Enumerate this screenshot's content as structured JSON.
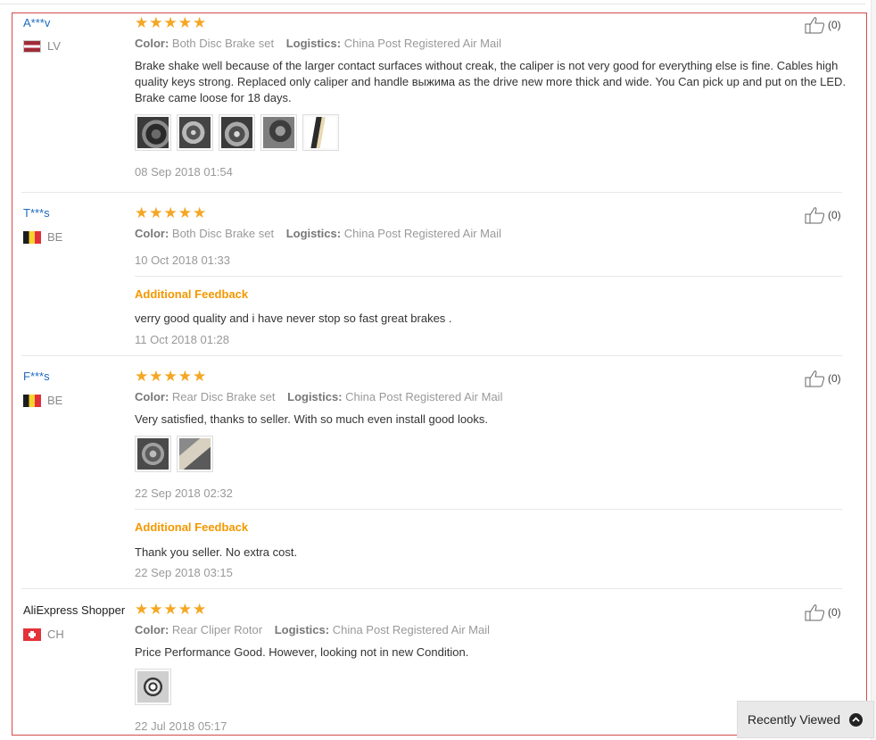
{
  "recently_viewed": {
    "label": "Recently Viewed",
    "icon": "chevron-up-circle-icon"
  },
  "reviews": [
    {
      "user": "A***v",
      "country_code": "LV",
      "stars": 5,
      "color_label": "Color:",
      "color_value": "Both Disc Brake set",
      "logistics_label": "Logistics:",
      "logistics_value": "China Post Registered Air Mail",
      "text": "Brake shake well because of the larger contact surfaces without creak, the caliper is not very good for everything else is fine. Cables high quality keys strong. Replaced only caliper and handle выжима as the drive new more thick and wide. You Can pick up and put on the LED. Brake came loose for 18 days.",
      "photo_count": 5,
      "date": "08 Sep 2018 01:54",
      "likes": "(0)"
    },
    {
      "user": "T***s",
      "country_code": "BE",
      "stars": 5,
      "color_label": "Color:",
      "color_value": "Both Disc Brake set",
      "logistics_label": "Logistics:",
      "logistics_value": "China Post Registered Air Mail",
      "date": "10 Oct 2018 01:33",
      "likes": "(0)",
      "additional_feedback_label": "Additional Feedback",
      "additional_text": "verry good quality and i have never stop so fast great brakes .",
      "additional_date": "11 Oct 2018 01:28"
    },
    {
      "user": "F***s",
      "country_code": "BE",
      "stars": 5,
      "color_label": "Color:",
      "color_value": "Rear Disc Brake set",
      "logistics_label": "Logistics:",
      "logistics_value": "China Post Registered Air Mail",
      "text": "Very satisfied, thanks to seller. With so much even install good looks.",
      "photo_count": 2,
      "date": "22 Sep 2018 02:32",
      "likes": "(0)",
      "additional_feedback_label": "Additional Feedback",
      "additional_text": "Thank you seller. No extra cost.",
      "additional_date": "22 Sep 2018 03:15"
    },
    {
      "user": "AliExpress Shopper",
      "country_code": "CH",
      "stars": 5,
      "color_label": "Color:",
      "color_value": "Rear Cliper Rotor",
      "logistics_label": "Logistics:",
      "logistics_value": "China Post Registered Air Mail",
      "text": "Price Performance Good. However, looking not in new Condition.",
      "photo_count": 1,
      "date": "22 Jul 2018 05:17",
      "likes": "(0)"
    }
  ],
  "colors": {
    "user_link": "#1f6ac1",
    "star": "#f5a623",
    "feedback_title": "#f39800",
    "frame": "#d44b4b"
  }
}
